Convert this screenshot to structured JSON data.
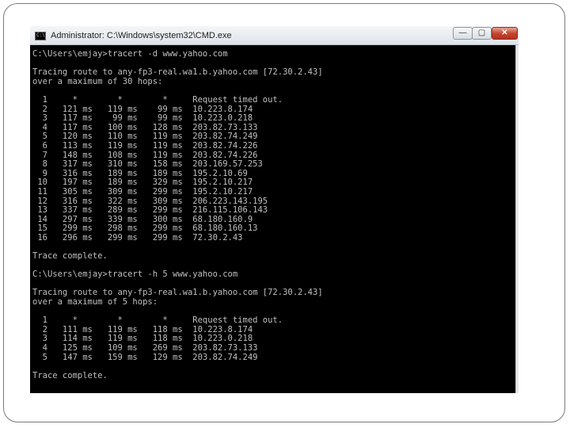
{
  "window": {
    "title": "Administrator: C:\\Windows\\system32\\CMD.exe",
    "icon": "cmd-icon",
    "icon_glyph": "C:\\",
    "buttons": {
      "minimize": "—",
      "maximize": "▢",
      "close": "✕"
    }
  },
  "console_lines": [
    "C:\\Users\\emjay>tracert -d www.yahoo.com",
    "",
    "Tracing route to any-fp3-real.wa1.b.yahoo.com [72.30.2.43]",
    "over a maximum of 30 hops:",
    "",
    "  1     *        *        *     Request timed out.",
    "  2   121 ms   119 ms    99 ms  10.223.8.174",
    "  3   117 ms    99 ms    99 ms  10.223.0.218",
    "  4   117 ms   100 ms   128 ms  203.82.73.133",
    "  5   120 ms   110 ms   119 ms  203.82.74.249",
    "  6   113 ms   119 ms   119 ms  203.82.74.226",
    "  7   148 ms   108 ms   119 ms  203.82.74.226",
    "  8   317 ms   310 ms   158 ms  203.169.57.253",
    "  9   316 ms   189 ms   189 ms  195.2.10.69",
    " 10   197 ms   189 ms   329 ms  195.2.10.217",
    " 11   305 ms   309 ms   299 ms  195.2.10.217",
    " 12   316 ms   322 ms   309 ms  206.223.143.195",
    " 13   337 ms   289 ms   299 ms  216.115.106.143",
    " 14   297 ms   339 ms   300 ms  68.180.160.9",
    " 15   299 ms   298 ms   299 ms  68.180.160.13",
    " 16   296 ms   299 ms   299 ms  72.30.2.43",
    "",
    "Trace complete.",
    "",
    "C:\\Users\\emjay>tracert -h 5 www.yahoo.com",
    "",
    "Tracing route to any-fp3-real.wa1.b.yahoo.com [72.30.2.43]",
    "over a maximum of 5 hops:",
    "",
    "  1     *        *        *     Request timed out.",
    "  2   111 ms   119 ms   118 ms  10.223.8.174",
    "  3   114 ms   119 ms   118 ms  10.223.0.218",
    "  4   125 ms   109 ms   269 ms  203.82.73.133",
    "  5   147 ms   159 ms   129 ms  203.82.74.249",
    "",
    "Trace complete."
  ],
  "colors": {
    "console_bg": "#000000",
    "console_text": "#c0c0c0",
    "close_button": "#c4412b"
  }
}
